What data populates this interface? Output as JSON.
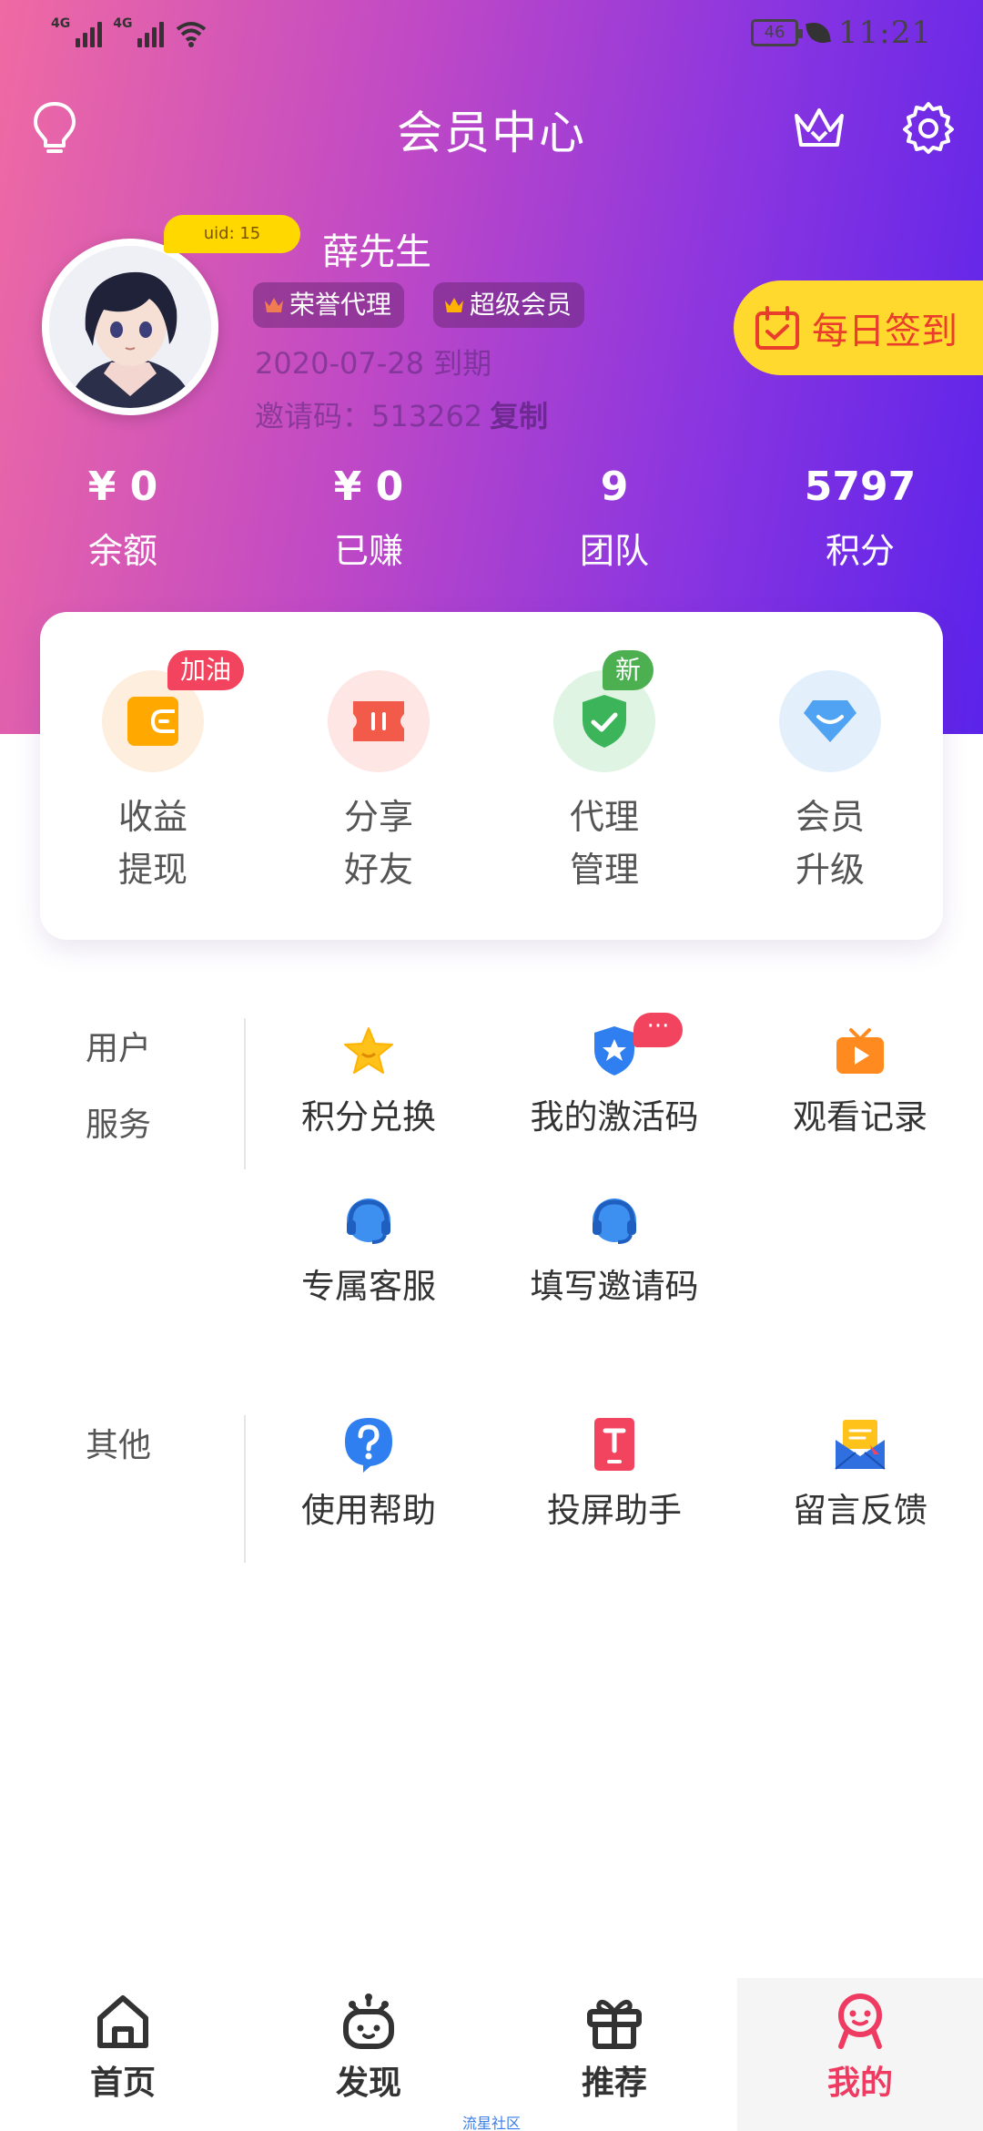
{
  "status": {
    "network1": "4G",
    "network2": "4G",
    "battery": "46",
    "time": "11:21"
  },
  "header": {
    "title": "会员中心"
  },
  "profile": {
    "uid": "uid: 15",
    "name": "薛先生",
    "tags": [
      "荣誉代理",
      "超级会员"
    ],
    "expire": "2020-07-28 到期",
    "invite_label": "邀请码：513262",
    "copy_label": "复制"
  },
  "checkin": {
    "label": "每日签到"
  },
  "stats": [
    {
      "value": "¥ 0",
      "label": "余额"
    },
    {
      "value": "¥ 0",
      "label": "已赚"
    },
    {
      "value": "9",
      "label": "团队"
    },
    {
      "value": "5797",
      "label": "积分"
    }
  ],
  "quick": [
    {
      "line1": "收益",
      "line2": "提现",
      "badge": "加油",
      "badge_color": "#f2445f"
    },
    {
      "line1": "分享",
      "line2": "好友",
      "badge": "",
      "badge_color": ""
    },
    {
      "line1": "代理",
      "line2": "管理",
      "badge": "新",
      "badge_color": "#4caf50"
    },
    {
      "line1": "会员",
      "line2": "升级",
      "badge": "",
      "badge_color": ""
    }
  ],
  "user_service": {
    "title_line1": "用户",
    "title_line2": "服务",
    "items": [
      {
        "label": "积分兑换",
        "icon": "star-icon"
      },
      {
        "label": "我的激活码",
        "icon": "shield-star-icon",
        "badge": "···"
      },
      {
        "label": "观看记录",
        "icon": "tv-play-icon"
      },
      {
        "label": "专属客服",
        "icon": "headset-icon"
      },
      {
        "label": "填写邀请码",
        "icon": "headset-icon"
      }
    ]
  },
  "other": {
    "title": "其他",
    "items": [
      {
        "label": "使用帮助",
        "icon": "question-icon"
      },
      {
        "label": "投屏助手",
        "icon": "cast-icon"
      },
      {
        "label": "留言反馈",
        "icon": "mail-icon"
      }
    ]
  },
  "nav": [
    {
      "label": "首页",
      "icon": "home-icon"
    },
    {
      "label": "发现",
      "icon": "discover-icon"
    },
    {
      "label": "推荐",
      "icon": "gift-icon"
    },
    {
      "label": "我的",
      "icon": "profile-icon",
      "active": true
    }
  ],
  "footer": {
    "text": "流星社区"
  },
  "colors": {
    "accent": "#ef3b62",
    "gradient_start": "#ef6aa3",
    "gradient_end": "#5b23ea",
    "checkin_bg": "#ffd92e"
  }
}
